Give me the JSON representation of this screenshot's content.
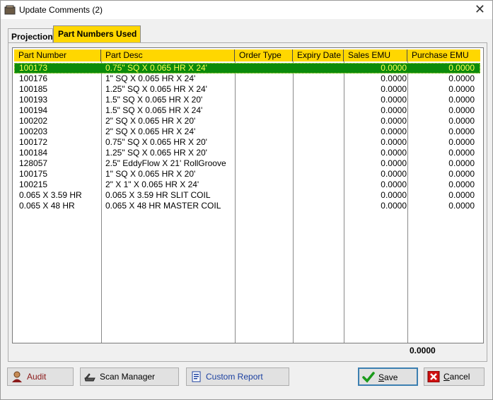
{
  "window": {
    "title": "Update Comments  (2)",
    "close_glyph": "✕"
  },
  "tabs": [
    {
      "label": "Projection",
      "active": false
    },
    {
      "label": "Part Numbers Used",
      "active": true
    }
  ],
  "grid": {
    "columns": [
      "Part Number",
      "Part Desc",
      "Order Type",
      "Expiry Date",
      "Sales EMU",
      "Purchase EMU"
    ],
    "rows": [
      {
        "part_number": "100173",
        "part_desc": "0.75\" SQ X 0.065 HR X 24'",
        "order_type": "",
        "expiry_date": "",
        "sales_emu": "0.0000",
        "purchase_emu": "0.0000",
        "selected": true
      },
      {
        "part_number": "100176",
        "part_desc": "1\" SQ X 0.065 HR X 24'",
        "order_type": "",
        "expiry_date": "",
        "sales_emu": "0.0000",
        "purchase_emu": "0.0000"
      },
      {
        "part_number": "100185",
        "part_desc": "1.25\" SQ X 0.065 HR X 24'",
        "order_type": "",
        "expiry_date": "",
        "sales_emu": "0.0000",
        "purchase_emu": "0.0000"
      },
      {
        "part_number": "100193",
        "part_desc": "1.5\" SQ X 0.065 HR X 20'",
        "order_type": "",
        "expiry_date": "",
        "sales_emu": "0.0000",
        "purchase_emu": "0.0000"
      },
      {
        "part_number": "100194",
        "part_desc": "1.5\" SQ X 0.065 HR X 24'",
        "order_type": "",
        "expiry_date": "",
        "sales_emu": "0.0000",
        "purchase_emu": "0.0000"
      },
      {
        "part_number": "100202",
        "part_desc": "2\" SQ X 0.065 HR X 20'",
        "order_type": "",
        "expiry_date": "",
        "sales_emu": "0.0000",
        "purchase_emu": "0.0000"
      },
      {
        "part_number": "100203",
        "part_desc": "2\" SQ X 0.065 HR X 24'",
        "order_type": "",
        "expiry_date": "",
        "sales_emu": "0.0000",
        "purchase_emu": "0.0000"
      },
      {
        "part_number": "100172",
        "part_desc": "0.75\" SQ X 0.065 HR X 20'",
        "order_type": "",
        "expiry_date": "",
        "sales_emu": "0.0000",
        "purchase_emu": "0.0000"
      },
      {
        "part_number": "100184",
        "part_desc": "1.25\" SQ X 0.065 HR X 20'",
        "order_type": "",
        "expiry_date": "",
        "sales_emu": "0.0000",
        "purchase_emu": "0.0000"
      },
      {
        "part_number": "128057",
        "part_desc": "2.5\" EddyFlow X 21' RollGroove",
        "order_type": "",
        "expiry_date": "",
        "sales_emu": "0.0000",
        "purchase_emu": "0.0000"
      },
      {
        "part_number": "100175",
        "part_desc": "1\" SQ X 0.065 HR X 20'",
        "order_type": "",
        "expiry_date": "",
        "sales_emu": "0.0000",
        "purchase_emu": "0.0000"
      },
      {
        "part_number": "100215",
        "part_desc": "2\" X 1\" X 0.065 HR X 24'",
        "order_type": "",
        "expiry_date": "",
        "sales_emu": "0.0000",
        "purchase_emu": "0.0000"
      },
      {
        "part_number": "0.065 X 3.59 HR",
        "part_desc": "0.065 X 3.59 HR SLIT COIL",
        "order_type": "",
        "expiry_date": "",
        "sales_emu": "0.0000",
        "purchase_emu": "0.0000"
      },
      {
        "part_number": "0.065 X 48 HR",
        "part_desc": "0.065 X 48 HR MASTER COIL",
        "order_type": "",
        "expiry_date": "",
        "sales_emu": "0.0000",
        "purchase_emu": "0.0000"
      }
    ],
    "total": "0.0000"
  },
  "buttons": {
    "audit": "Audit",
    "scan_manager": "Scan Manager",
    "custom_report": "Custom Report",
    "save_first": "S",
    "save_rest": "ave",
    "cancel_first": "C",
    "cancel_rest": "ancel"
  },
  "icons": {
    "app": "window-app-icon",
    "audit": "person-audit-icon",
    "scan": "scanner-icon",
    "report": "report-document-icon",
    "save": "green-checkmark-icon",
    "cancel": "red-x-icon"
  },
  "colors": {
    "tab_active": "#ffd700",
    "header": "#ffd700",
    "selected_row": "#0b8a0b",
    "selected_text": "#ffff4d"
  }
}
